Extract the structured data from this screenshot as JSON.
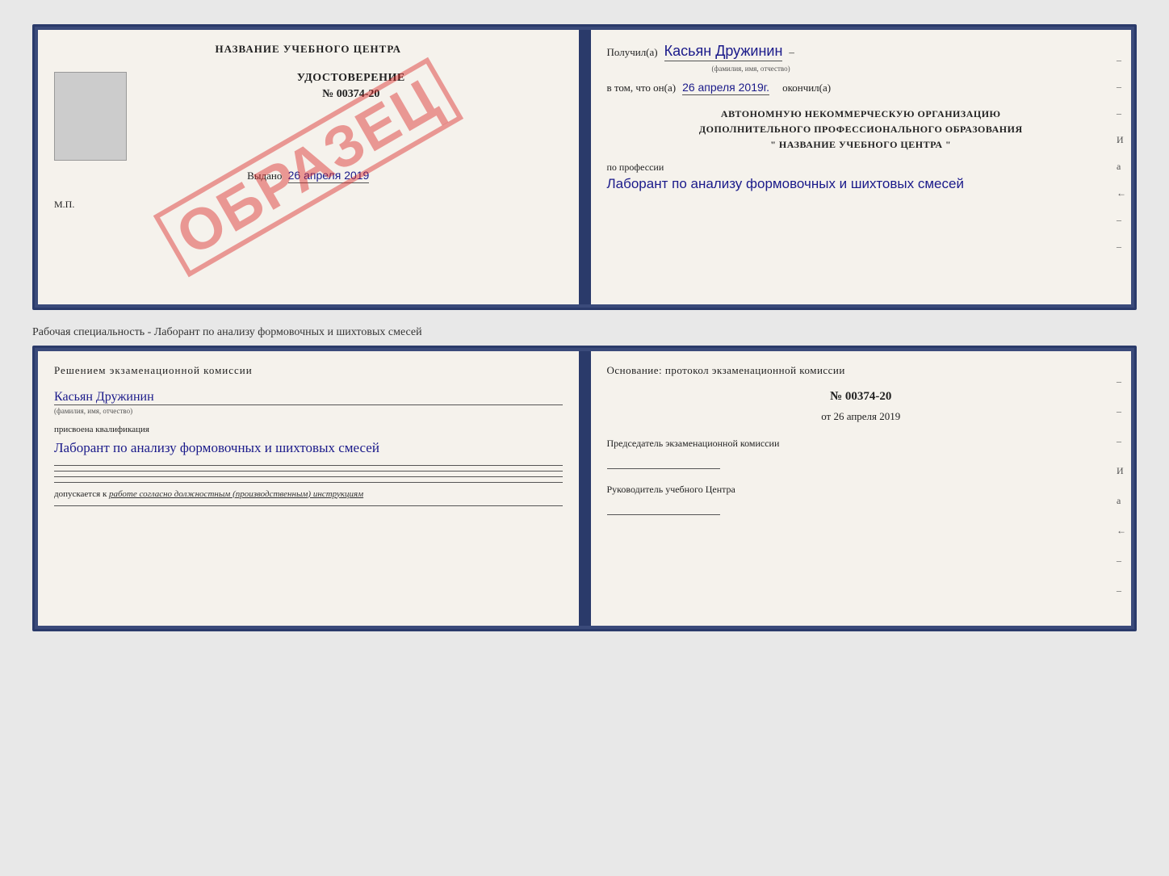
{
  "top_book": {
    "left_page": {
      "title": "НАЗВАНИЕ УЧЕБНОГО ЦЕНТРА",
      "photo_placeholder": "",
      "udost_label": "УДОСТОВЕРЕНИЕ",
      "number": "№ 00374-20",
      "vydano_label": "Выдано",
      "vydano_date": "26 апреля 2019",
      "mp_label": "М.П.",
      "stamp": "ОБРАЗЕЦ"
    },
    "right_page": {
      "poluchil_label": "Получил(а)",
      "poluchil_name": "Касьян Дружинин",
      "poluchil_sub": "(фамилия, имя, отчество)",
      "vtom_label": "в том, что он(а)",
      "vtom_date": "26 апреля 2019г.",
      "okonchil_label": "окончил(а)",
      "org_line1": "АВТОНОМНУЮ НЕКОММЕРЧЕСКУЮ ОРГАНИЗАЦИЮ",
      "org_line2": "ДОПОЛНИТЕЛЬНОГО ПРОФЕССИОНАЛЬНОГО ОБРАЗОВАНИЯ",
      "org_line3": "\"  НАЗВАНИЕ УЧЕБНОГО ЦЕНТРА  \"",
      "po_professii_label": "по профессии",
      "profession": "Лаборант по анализу формовочных и шихтовых смесей",
      "dashes": [
        "-",
        "-",
        "-",
        "И",
        "а",
        "←",
        "-",
        "-"
      ]
    }
  },
  "middle_text": "Рабочая специальность - Лаборант по анализу формовочных и шихтовых смесей",
  "bottom_book": {
    "left_page": {
      "resheniem_label": "Решением экзаменационной комиссии",
      "name": "Касьян Дружинин",
      "name_sub": "(фамилия, имя, отчество)",
      "prisvoena_label": "присвоена квалификация",
      "qualification": "Лаборант по анализу формовочных и шихтовых смесей",
      "dopusk_label": "допускается к",
      "dopusk_text": "работе согласно должностным (производственным) инструкциям"
    },
    "right_page": {
      "osnovanie_label": "Основание: протокол экзаменационной комиссии",
      "protocol_number": "№ 00374-20",
      "ot_label": "от",
      "ot_date": "26 апреля 2019",
      "predsedatel_label": "Председатель экзаменационной комиссии",
      "rukovoditel_label": "Руководитель учебного Центра",
      "dashes": [
        "-",
        "-",
        "-",
        "И",
        "а",
        "←",
        "-",
        "-"
      ]
    }
  }
}
